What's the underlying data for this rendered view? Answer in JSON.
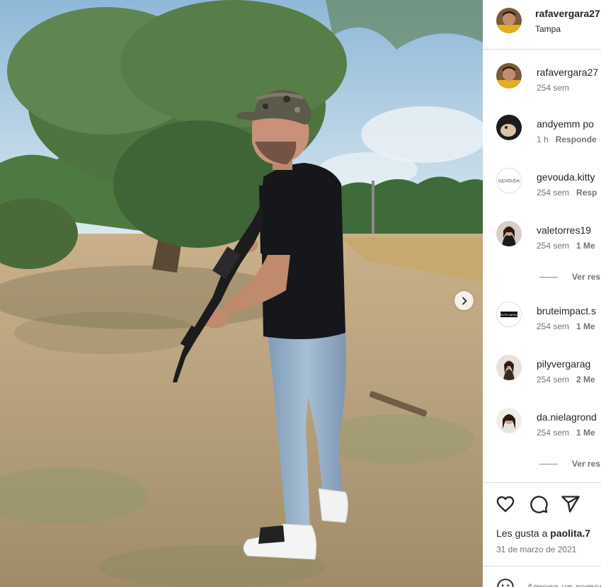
{
  "post": {
    "username": "rafavergara27",
    "location": "Tampa",
    "likes_prefix": "Les gusta a ",
    "likes_user": "paolita.7",
    "date": "31 de marzo de 2021",
    "add_comment_placeholder": "Agrega un comentario..."
  },
  "comments": [
    {
      "user": "rafavergara27",
      "time": "254 sem",
      "extra": ""
    },
    {
      "user": "andyemm",
      "text": "po",
      "time": "1 h",
      "extra": "Responde"
    },
    {
      "user": "gevouda.kitty",
      "time": "254 sem",
      "extra": "Resp",
      "avatar_text": "GEVOUDA"
    },
    {
      "user": "valetorres19",
      "time": "254 sem",
      "extra": "1 Me"
    },
    {
      "user": "bruteimpact.s",
      "time": "254 sem",
      "extra": "1 Me",
      "avatar_text": "BRUTE IMPACT"
    },
    {
      "user": "pilyvergarag",
      "time": "254 sem",
      "extra": "2 Me"
    },
    {
      "user": "da.nielagrond",
      "time": "254 sem",
      "extra": "1 Me"
    }
  ],
  "view_replies_label": "Ver res",
  "icons": {
    "like": "heart-icon",
    "comment": "comment-icon",
    "share": "share-icon",
    "next": "chevron-right-icon",
    "emoji": "emoji-icon"
  }
}
